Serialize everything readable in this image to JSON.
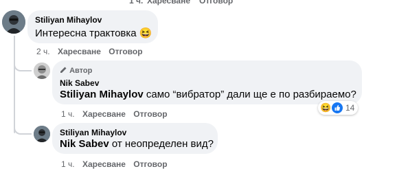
{
  "top_actions": {
    "time": "1 ч.",
    "like": "Харесване",
    "reply": "Отговор"
  },
  "comments": [
    {
      "author": "Stiliyan Mihaylov",
      "text": "Интересна трактовка",
      "emoji": "😆",
      "time": "2 ч.",
      "like_label": "Харесване",
      "reply_label": "Отговор"
    },
    {
      "badge": "Автор",
      "author": "Nik Sabev",
      "mention": "Stiliyan Mihaylov",
      "text": " само “вибратор” дали ще е по разбираемо?",
      "time": "1 ч.",
      "like_label": "Харесване",
      "reply_label": "Отговор",
      "reactions_count": "14"
    },
    {
      "author": "Stiliyan Mihaylov",
      "mention": "Nik Sabev",
      "text": " от неопределен вид?",
      "time": "1 ч.",
      "like_label": "Харесване",
      "reply_label": "Отговор"
    }
  ],
  "colors": {
    "bubble": "#f0f2f5",
    "meta": "#65676b",
    "like_blue": "#1877f2",
    "text": "#050505"
  }
}
